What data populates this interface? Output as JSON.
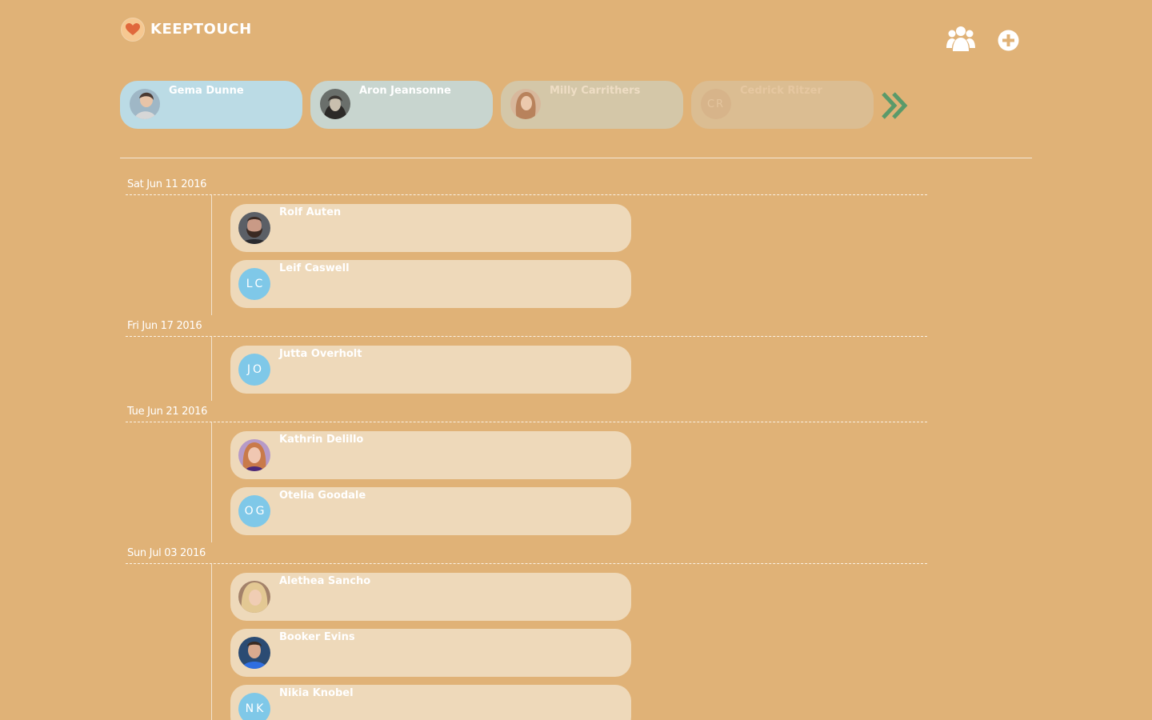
{
  "app": {
    "title": "KEEPTOUCH",
    "logo_icon": "heart-icon",
    "header_icons": [
      "group-icon",
      "add-circle-icon"
    ]
  },
  "favorites": [
    {
      "name": "Gema Dunne",
      "avatar": "photo"
    },
    {
      "name": "Aron Jeansonne",
      "avatar": "photo"
    },
    {
      "name": "Milly Carrithers",
      "avatar": "photo"
    },
    {
      "name": "Cedrick Ritzer",
      "avatar": "initials",
      "initials": "CR"
    }
  ],
  "favorites_next_icon": "double-chevron-right-icon",
  "timeline": [
    {
      "date": "Sat Jun 11 2016",
      "entries": [
        {
          "name": "Rolf Auten",
          "avatar": "photo"
        },
        {
          "name": "Leif Caswell",
          "avatar": "initials",
          "initials": "LC"
        }
      ]
    },
    {
      "date": "Fri Jun 17 2016",
      "entries": [
        {
          "name": "Jutta Overholt",
          "avatar": "initials",
          "initials": "JO"
        }
      ]
    },
    {
      "date": "Tue Jun 21 2016",
      "entries": [
        {
          "name": "Kathrin Delillo",
          "avatar": "photo"
        },
        {
          "name": "Otelia Goodale",
          "avatar": "initials",
          "initials": "OG"
        }
      ]
    },
    {
      "date": "Sun Jul 03 2016",
      "entries": [
        {
          "name": "Alethea Sancho",
          "avatar": "photo"
        },
        {
          "name": "Booker Evins",
          "avatar": "photo"
        },
        {
          "name": "Nikia Knobel",
          "avatar": "initials",
          "initials": "NK"
        }
      ]
    }
  ],
  "colors": {
    "background": "#e0b277",
    "card": "#eed9ba",
    "initials_avatar": "#7fc8e8",
    "accent_green": "#5a9a6a",
    "heart": "#e0683c"
  }
}
